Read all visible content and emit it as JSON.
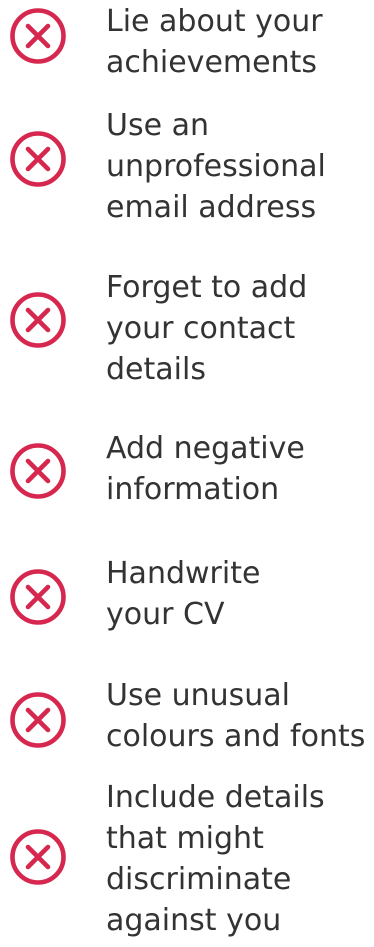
{
  "colors": {
    "icon": "#d6274f",
    "text": "#333333",
    "background": "#ffffff"
  },
  "icon_name": "cross-circle-icon",
  "items": [
    {
      "lines": [
        "Lie about your",
        "achievements"
      ]
    },
    {
      "lines": [
        "Use an",
        "unprofessional",
        "email address"
      ]
    },
    {
      "lines": [
        "Forget to add",
        "your contact",
        "details"
      ]
    },
    {
      "lines": [
        "Add negative",
        "information"
      ]
    },
    {
      "lines": [
        "Handwrite",
        "your CV"
      ]
    },
    {
      "lines": [
        "Use unusual",
        "colours and fonts"
      ]
    },
    {
      "lines": [
        "Include details",
        "that might",
        "discriminate",
        "against you"
      ]
    }
  ]
}
